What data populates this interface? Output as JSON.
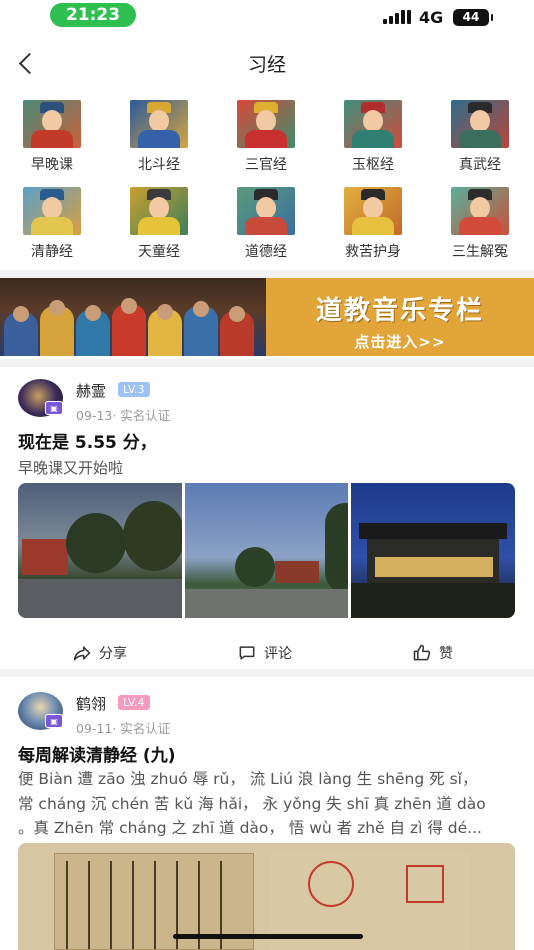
{
  "status_bar": {
    "time": "21:23",
    "network": "4G",
    "battery": "44"
  },
  "nav": {
    "title": "习经"
  },
  "scriptures": [
    {
      "label": "早晚课"
    },
    {
      "label": "北斗经"
    },
    {
      "label": "三官经"
    },
    {
      "label": "玉枢经"
    },
    {
      "label": "真武经"
    },
    {
      "label": "清静经"
    },
    {
      "label": "天童经"
    },
    {
      "label": "道德经"
    },
    {
      "label": "救苦护身"
    },
    {
      "label": "三生解冤"
    }
  ],
  "banner": {
    "title": "道教音乐专栏",
    "cta": "点击进入>>",
    "accent": "#e2a53a"
  },
  "posts": [
    {
      "username": "赫霊",
      "level": "LV.3",
      "level_color": "#9dc3f5",
      "date": "09-13",
      "verified": "· 实名认证",
      "title": "现在是 5.55 分，",
      "text": "早晚课又开始啦"
    },
    {
      "username": "鹤翎",
      "level": "LV.4",
      "level_color": "#f59bbf",
      "date": "09-11",
      "verified": "· 实名认证",
      "title": "每周解读清静经 (九)",
      "lines": [
        "便 Biàn 遭 zāo 浊 zhuó 辱 rǔ， 流 Liú 浪 làng 生 shēng 死 sǐ，",
        "常 cháng 沉 chén 苦 kǔ 海 hǎi， 永 yǒng 失 shī 真 zhēn 道 dào",
        "。真 Zhēn 常 cháng 之 zhī 道 dào， 悟 wù 者 zhě 自 zì 得 dé..."
      ]
    }
  ],
  "actions": {
    "share": "分享",
    "comment": "评论",
    "like": "赞"
  }
}
